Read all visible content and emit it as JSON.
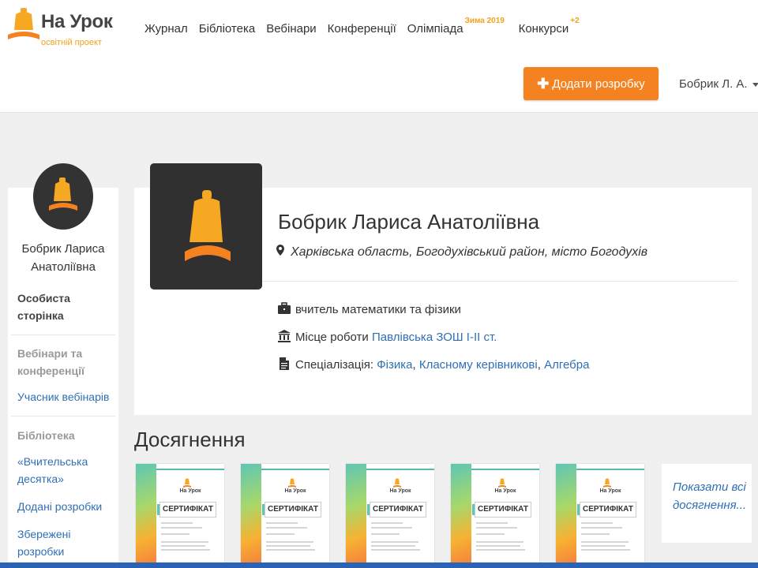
{
  "brand": {
    "name": "На Урок",
    "tagline": "освітній проект"
  },
  "nav": {
    "items": [
      {
        "label": "Журнал"
      },
      {
        "label": "Бібліотека"
      },
      {
        "label": "Вебінари"
      },
      {
        "label": "Конференції"
      },
      {
        "label": "Олімпіада",
        "badge": "Зима 2019"
      },
      {
        "label": "Конкурси",
        "badge": "+2"
      }
    ]
  },
  "header": {
    "add_button_label": "Додати розробку",
    "user_label": "Бобрик Л. А."
  },
  "sidebar": {
    "name": "Бобрик Лариса Анатоліївна",
    "personal_page": "Особиста сторінка",
    "webinars_heading": "Вебінари та конференції",
    "webinar_participant": "Учасник вебінарів",
    "library_heading": "Бібліотека",
    "top_ten": "«Вчительська десятка»",
    "added": "Додані розробки",
    "saved": "Збережені розробки"
  },
  "profile": {
    "name": "Бобрик Лариса Анатоліївна",
    "location": "Харківська область, Богодухівський район, місто Богодухів",
    "position": "вчитель математики та фізики",
    "workplace_label": "Місце роботи",
    "workplace": "Павлівська ЗОШ І-ІІ ст.",
    "specialization_label": "Спеціалізація:",
    "specializations": [
      "Фізика",
      "Класному керівникові",
      "Алгебра"
    ]
  },
  "achievements": {
    "title": "Досягнення",
    "certificate_brand": "На Урок",
    "certificate_title": "СЕРТИФІКАТ",
    "show_all": "Показати всі досягнення..."
  },
  "colors": {
    "accent": "#f58220",
    "link": "#2f6fb5",
    "bell": "#f7a823"
  }
}
